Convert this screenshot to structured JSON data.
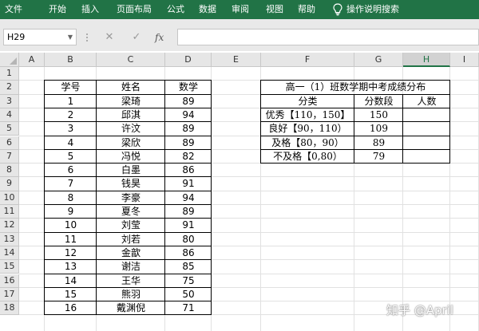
{
  "ribbon": {
    "tabs": [
      "文件",
      "开始",
      "插入",
      "页面布局",
      "公式",
      "数据",
      "审阅",
      "视图",
      "帮助"
    ],
    "tell_me": "操作说明搜索",
    "color": "#217346"
  },
  "formula_bar": {
    "name_box": "H29",
    "fx_label": "fx",
    "cancel_icon": "✕",
    "enter_icon": "✓",
    "value": ""
  },
  "columns": [
    "A",
    "B",
    "C",
    "D",
    "E",
    "F",
    "G",
    "H",
    "I"
  ],
  "rows": [
    "1",
    "2",
    "3",
    "4",
    "5",
    "6",
    "7",
    "8",
    "9",
    "10",
    "11",
    "12",
    "13",
    "14",
    "15",
    "16",
    "17",
    "18"
  ],
  "student_table": {
    "headers": [
      "学号",
      "姓名",
      "数学"
    ],
    "rows": [
      [
        "1",
        "梁琦",
        "89"
      ],
      [
        "2",
        "邱淇",
        "94"
      ],
      [
        "3",
        "许汶",
        "89"
      ],
      [
        "4",
        "梁欣",
        "89"
      ],
      [
        "5",
        "冯悦",
        "82"
      ],
      [
        "6",
        "白墨",
        "86"
      ],
      [
        "7",
        "钱昊",
        "91"
      ],
      [
        "8",
        "李豪",
        "94"
      ],
      [
        "9",
        "夏冬",
        "89"
      ],
      [
        "10",
        "刘莹",
        "91"
      ],
      [
        "11",
        "刘若",
        "80"
      ],
      [
        "12",
        "金歆",
        "86"
      ],
      [
        "13",
        "谢洁",
        "85"
      ],
      [
        "14",
        "王华",
        "75"
      ],
      [
        "15",
        "熊羽",
        "50"
      ],
      [
        "16",
        "戴渊倪",
        "71"
      ]
    ]
  },
  "grade_table": {
    "title": "高一（1）班数学期中考成绩分布",
    "headers": [
      "分类",
      "分数段",
      "人数"
    ],
    "rows": [
      [
        "优秀【110，150】",
        "150",
        ""
      ],
      [
        "良好【90，110）",
        "109",
        ""
      ],
      [
        "及格【80，90）",
        "89",
        ""
      ],
      [
        "不及格【0,80）",
        "79",
        ""
      ]
    ]
  },
  "watermark": "知乎 @April"
}
